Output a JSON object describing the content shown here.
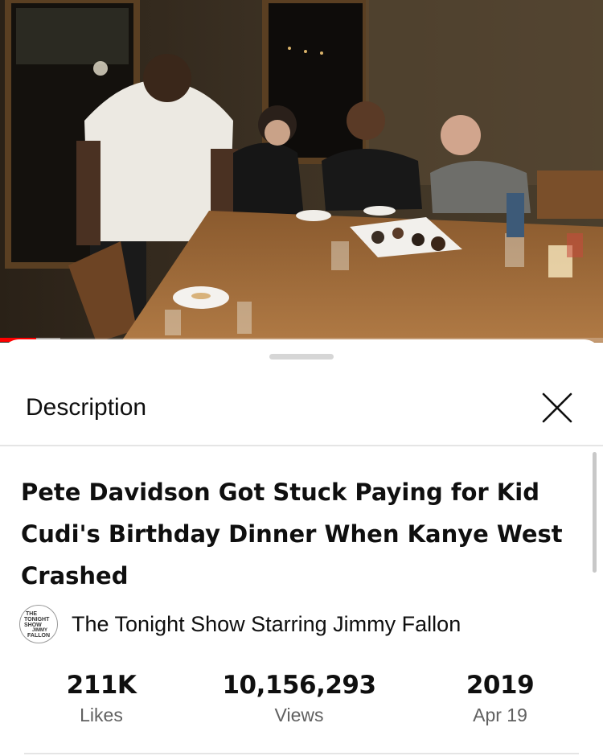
{
  "player": {
    "progress": 0.06,
    "buffered": 0.1,
    "progress_color": "#ff0000"
  },
  "sheet": {
    "title": "Description",
    "close_icon": "close-icon"
  },
  "video": {
    "title": "Pete Davidson Got Stuck Paying for Kid Cudi's Birthday Dinner When Kanye West Crashed",
    "channel": {
      "name": "The Tonight Show Starring Jimmy Fallon",
      "logo_lines": [
        "THE",
        "TONIGHT",
        "SHOW",
        "JIMMY",
        "FALLON"
      ]
    },
    "stats": [
      {
        "value": "211K",
        "label": "Likes"
      },
      {
        "value": "10,156,293",
        "label": "Views"
      },
      {
        "value": "2019",
        "label": "Apr 19"
      }
    ]
  }
}
